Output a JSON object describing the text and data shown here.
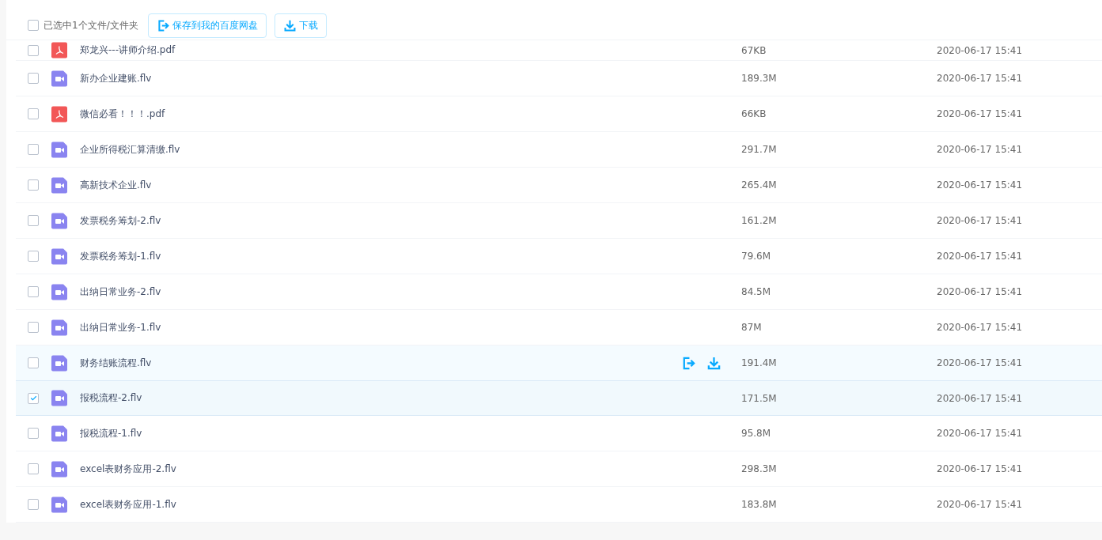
{
  "toolbar": {
    "select_all": {
      "label": "已选中1个文件/文件夹",
      "checked": false
    },
    "buttons": [
      {
        "kind": "save",
        "label": "保存到我的百度网盘"
      },
      {
        "kind": "download",
        "label": "下载"
      }
    ]
  },
  "files": [
    {
      "name": "郑龙兴---讲师介绍.pdf",
      "kind": "pdf",
      "size": "67KB",
      "date": "2020-06-17 15:41",
      "selected": false,
      "hovered": false,
      "partial": true
    },
    {
      "name": "新办企业建账.flv",
      "kind": "video",
      "size": "189.3M",
      "date": "2020-06-17 15:41",
      "selected": false,
      "hovered": false
    },
    {
      "name": "微信必看！！！.pdf",
      "kind": "pdf",
      "size": "66KB",
      "date": "2020-06-17 15:41",
      "selected": false,
      "hovered": false
    },
    {
      "name": "企业所得税汇算清缴.flv",
      "kind": "video",
      "size": "291.7M",
      "date": "2020-06-17 15:41",
      "selected": false,
      "hovered": false
    },
    {
      "name": "高新技术企业.flv",
      "kind": "video",
      "size": "265.4M",
      "date": "2020-06-17 15:41",
      "selected": false,
      "hovered": false
    },
    {
      "name": "发票税务筹划-2.flv",
      "kind": "video",
      "size": "161.2M",
      "date": "2020-06-17 15:41",
      "selected": false,
      "hovered": false
    },
    {
      "name": "发票税务筹划-1.flv",
      "kind": "video",
      "size": "79.6M",
      "date": "2020-06-17 15:41",
      "selected": false,
      "hovered": false
    },
    {
      "name": "出纳日常业务-2.flv",
      "kind": "video",
      "size": "84.5M",
      "date": "2020-06-17 15:41",
      "selected": false,
      "hovered": false
    },
    {
      "name": "出纳日常业务-1.flv",
      "kind": "video",
      "size": "87M",
      "date": "2020-06-17 15:41",
      "selected": false,
      "hovered": false
    },
    {
      "name": "财务结账流程.flv",
      "kind": "video",
      "size": "191.4M",
      "date": "2020-06-17 15:41",
      "selected": false,
      "hovered": true
    },
    {
      "name": "报税流程-2.flv",
      "kind": "video",
      "size": "171.5M",
      "date": "2020-06-17 15:41",
      "selected": true,
      "hovered": false
    },
    {
      "name": "报税流程-1.flv",
      "kind": "video",
      "size": "95.8M",
      "date": "2020-06-17 15:41",
      "selected": false,
      "hovered": false
    },
    {
      "name": "excel表财务应用-2.flv",
      "kind": "video",
      "size": "298.3M",
      "date": "2020-06-17 15:41",
      "selected": false,
      "hovered": false
    },
    {
      "name": "excel表财务应用-1.flv",
      "kind": "video",
      "size": "183.8M",
      "date": "2020-06-17 15:41",
      "selected": false,
      "hovered": false
    }
  ]
}
